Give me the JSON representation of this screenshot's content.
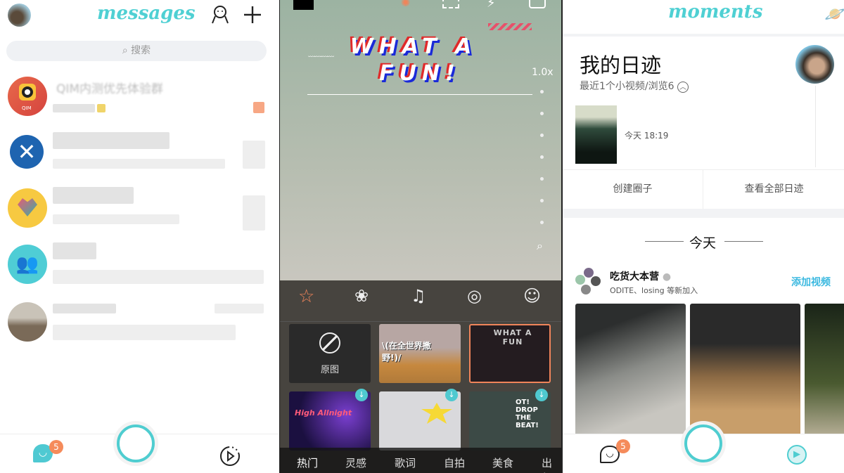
{
  "messages": {
    "title": "messages",
    "search_placeholder": "搜索",
    "chats": [
      {
        "name": "QIM内测优先体验群",
        "avatar_label": "QIM"
      }
    ],
    "badge_count": "5"
  },
  "camera": {
    "sticker_line1": "WHAT A",
    "sticker_line2": "FUN!",
    "zoom_level": "1.0x",
    "original_label": "原图",
    "tiles": [
      {
        "label": "\\(在全世界撒野!)/"
      },
      {
        "label": "WHAT A FUN"
      },
      {
        "label": "High Allnight"
      },
      {
        "label": ""
      },
      {
        "label": "OT! DROP THE BEAT!"
      }
    ],
    "categories": [
      "热门",
      "灵感",
      "歌词",
      "自拍",
      "美食",
      "出行"
    ],
    "accent": "#f0845a"
  },
  "moments": {
    "title": "moments",
    "diary_title": "我的日迹",
    "diary_subtitle": "最近1个小视频/浏览6",
    "diary_time": "今天 18:19",
    "create_circle": "创建圈子",
    "view_all": "查看全部日迹",
    "divider": "今天",
    "group_name": "吃货大本营",
    "group_members": "ODITE、losing 等新加入",
    "add_video": "添加视频",
    "badge_count": "5",
    "accent": "#4fcdd0"
  }
}
